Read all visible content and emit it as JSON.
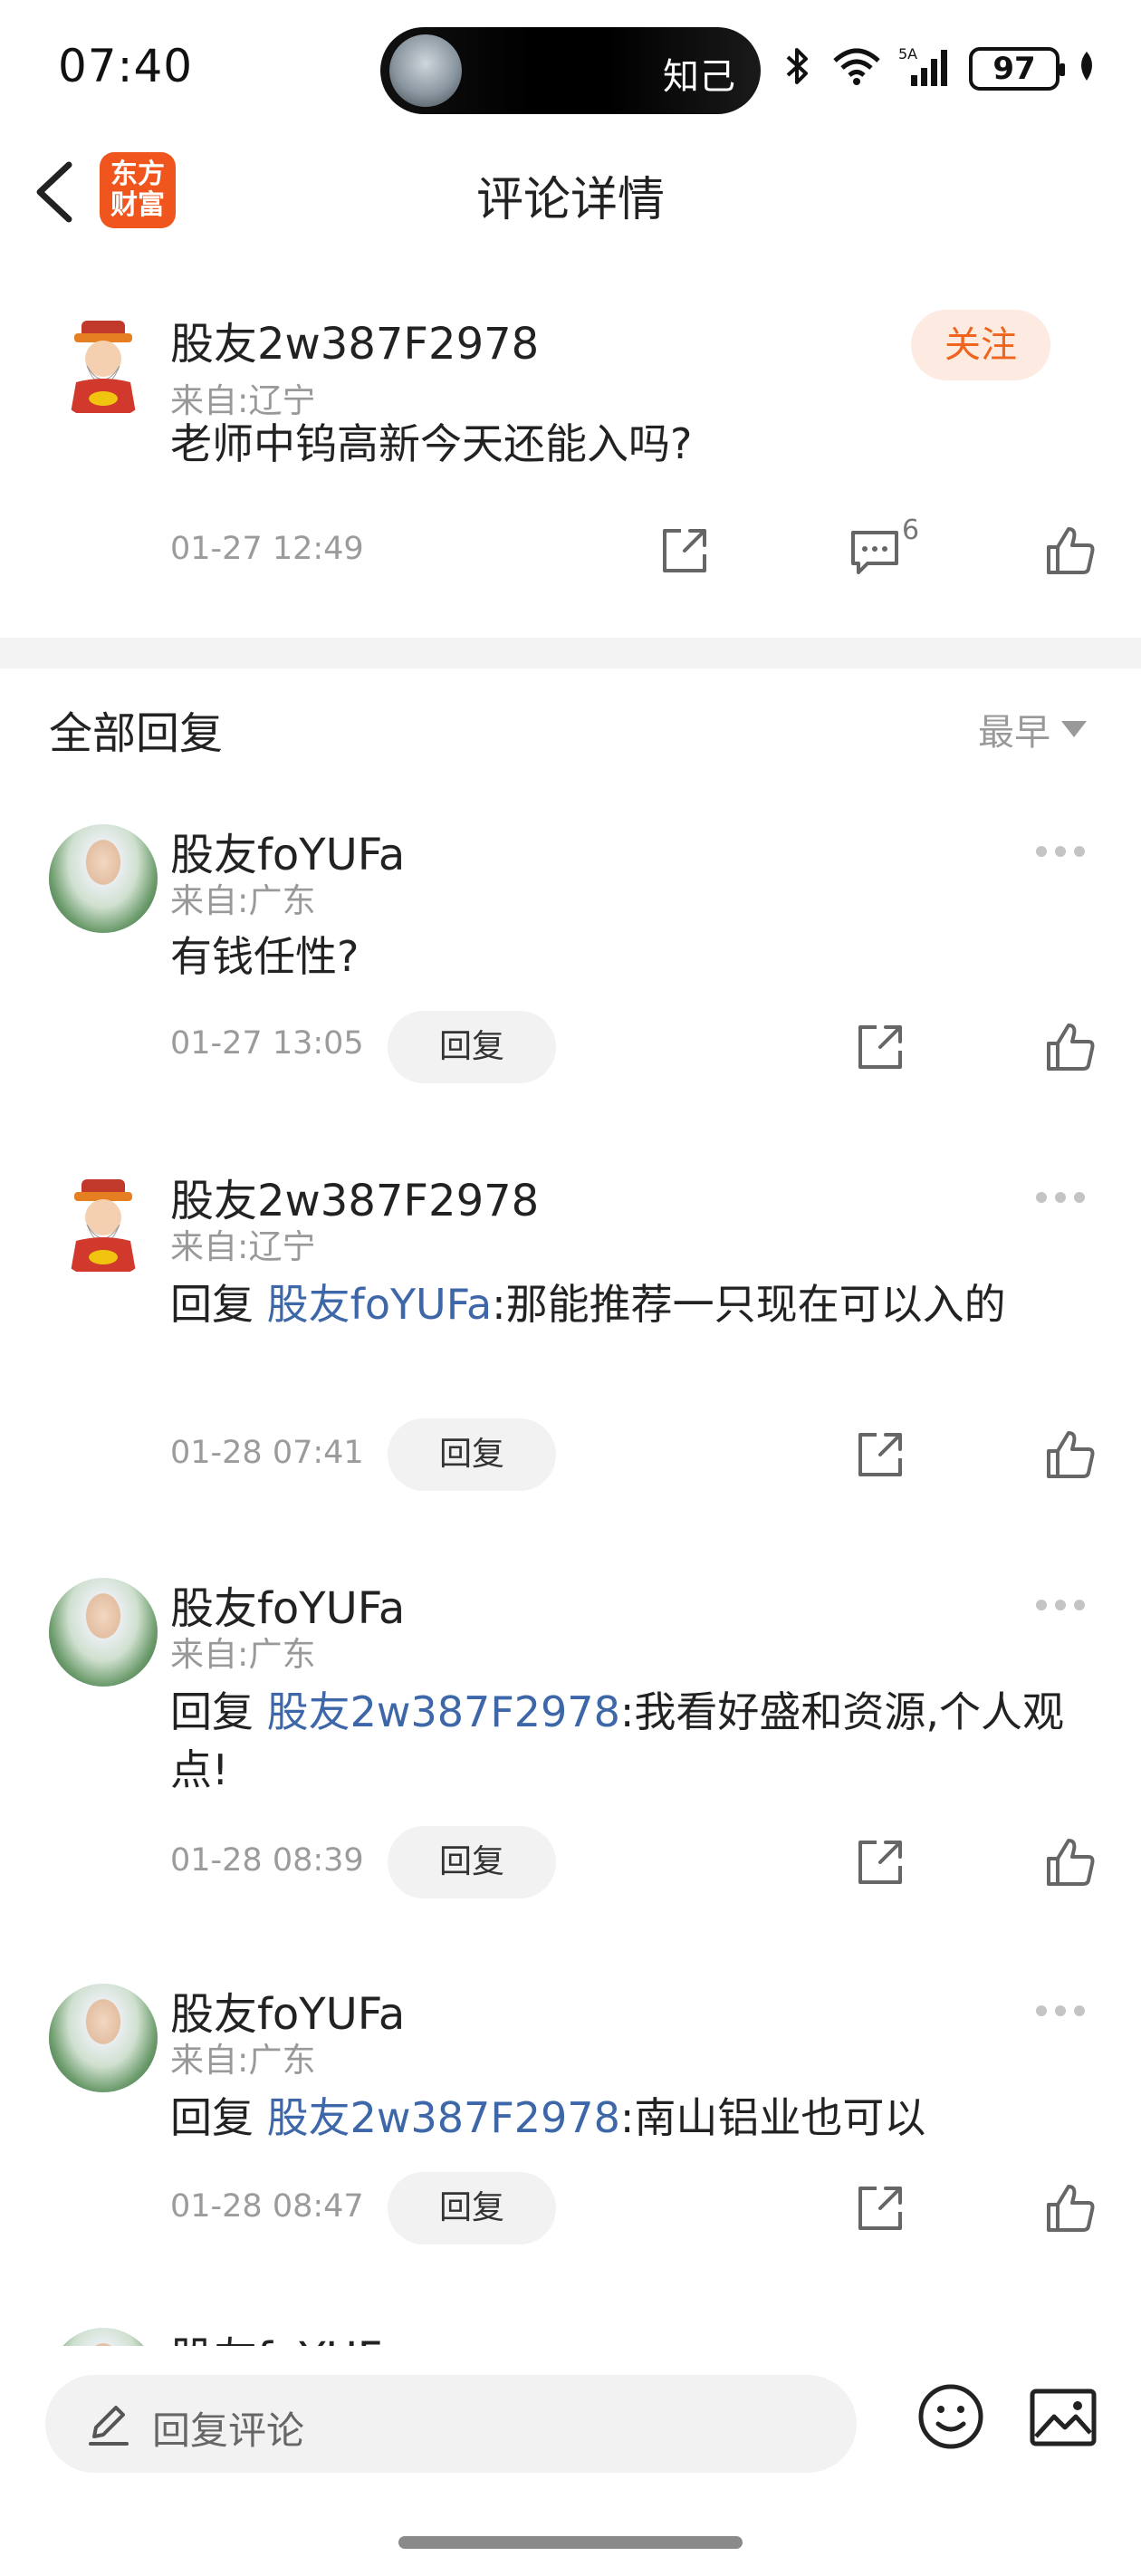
{
  "status_bar": {
    "time": "07:40",
    "pill_text": "知己",
    "battery": "97",
    "network": "5A"
  },
  "header": {
    "title": "评论详情",
    "logo_text": "东方财富"
  },
  "main_comment": {
    "username": "股友2w387F2978",
    "region": "来自:辽宁",
    "text": "老师中钨高新今天还能入吗?",
    "time": "01-27 12:49",
    "comment_count": "6",
    "follow_label": "关注"
  },
  "replies_section": {
    "title": "全部回复",
    "sort_label": "最早"
  },
  "replies": [
    {
      "username": "股友foYUFa",
      "region": "来自:广东",
      "lead": "",
      "mention": "",
      "text": "有钱任性?",
      "time": "01-27 13:05",
      "reply_label": "回复"
    },
    {
      "username": "股友2w387F2978",
      "region": "来自:辽宁",
      "lead": " 回复 ",
      "mention": "股友foYUFa",
      "text": ":那能推荐一只现在可以入的",
      "time": "01-28 07:41",
      "reply_label": "回复"
    },
    {
      "username": "股友foYUFa",
      "region": "来自:广东",
      "lead": " 回复 ",
      "mention": "股友2w387F2978",
      "text": ":我看好盛和资源,个人观点!",
      "time": "01-28 08:39",
      "reply_label": "回复"
    },
    {
      "username": "股友foYUFa",
      "region": "来自:广东",
      "lead": " 回复 ",
      "mention": "股友2w387F2978",
      "text": ":南山铝业也可以",
      "time": "01-28 08:47",
      "reply_label": "回复"
    },
    {
      "username": "股友foYUFa"
    }
  ],
  "bottom_bar": {
    "input_placeholder": "回复评论"
  },
  "colors": {
    "accent_orange": "#f0651e",
    "mention_blue": "#3d67a8",
    "muted_gray": "#999999"
  },
  "icons": [
    "back-arrow-icon",
    "share-icon",
    "comment-icon",
    "thumbs-up-icon",
    "more-dots-icon",
    "pen-icon",
    "emoji-icon",
    "image-icon",
    "bluetooth-icon",
    "wifi-icon",
    "signal-icon",
    "battery-icon"
  ]
}
